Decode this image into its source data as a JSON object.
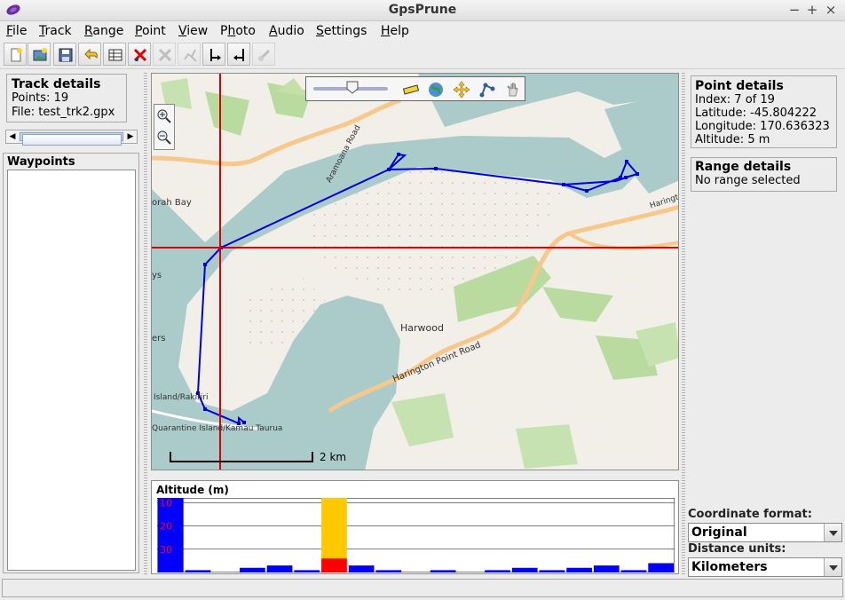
{
  "window": {
    "title": "GpsPrune"
  },
  "window_controls": {
    "minimize": "−",
    "maximize": "+",
    "close": "×"
  },
  "menu": [
    {
      "label": "File",
      "mnemonic": "F"
    },
    {
      "label": "Track",
      "mnemonic": "T"
    },
    {
      "label": "Range",
      "mnemonic": "R"
    },
    {
      "label": "Point",
      "mnemonic": "P"
    },
    {
      "label": "View",
      "mnemonic": "V"
    },
    {
      "label": "Photo",
      "mnemonic": "h"
    },
    {
      "label": "Audio",
      "mnemonic": "A"
    },
    {
      "label": "Settings",
      "mnemonic": "S"
    },
    {
      "label": "Help",
      "mnemonic": "H"
    }
  ],
  "toolbar_icons": [
    "new-file-icon",
    "add-photo-icon",
    "save-icon",
    "undo-icon",
    "edit-table-icon",
    "delete-point-icon",
    "delete-range-icon",
    "crop-icon",
    "set-range-start-icon",
    "set-range-end-icon",
    "connect-icon"
  ],
  "track_details": {
    "title": "Track details",
    "points": "Points: 19",
    "file": "File: test_trk2.gpx"
  },
  "waypoints": {
    "title": "Waypoints"
  },
  "map": {
    "scale_label": "2 km",
    "labels": [
      "orah Bay",
      "Harwood",
      "Harington Point Road",
      "Aramoana Road",
      "Island/Rakiriri",
      "Quarantine Island/Kamau Taurua",
      "Harington",
      "ys",
      "ers"
    ],
    "cursor_point_index": 7
  },
  "altitude": {
    "title": "Altitude (m)",
    "y_ticks": [
      "30",
      "20",
      "10"
    ]
  },
  "chart_data": {
    "type": "bar",
    "title": "Altitude (m)",
    "ylim": [
      0,
      32
    ],
    "y_ticks": [
      10,
      20,
      30
    ],
    "values": [
      34,
      1,
      0,
      2,
      3,
      1,
      6,
      3,
      1,
      0,
      1,
      0,
      1,
      2,
      1,
      2,
      3,
      1,
      4
    ],
    "selected_index": 6,
    "colors": {
      "bar": "#0000ff",
      "selected": "#ffc800",
      "selected_base": "#ff0000",
      "tick_text": "#ff0000"
    }
  },
  "point_details": {
    "title": "Point details",
    "index": "Index: 7 of 19",
    "latitude": "Latitude: -45.804222",
    "longitude": "Longitude: 170.636323",
    "altitude": "Altitude: 5 m"
  },
  "range_details": {
    "title": "Range details",
    "value": "No range selected"
  },
  "coordinate_format": {
    "label": "Coordinate format:",
    "value": "Original"
  },
  "distance_units": {
    "label": "Distance units:",
    "value": "Kilometers"
  },
  "colors": {
    "track": "#0000dd",
    "cursor": "#dd0000",
    "water": "#aacbca",
    "land": "#f2efe9",
    "green": "#b9dba0",
    "road": "#f7c88c"
  }
}
